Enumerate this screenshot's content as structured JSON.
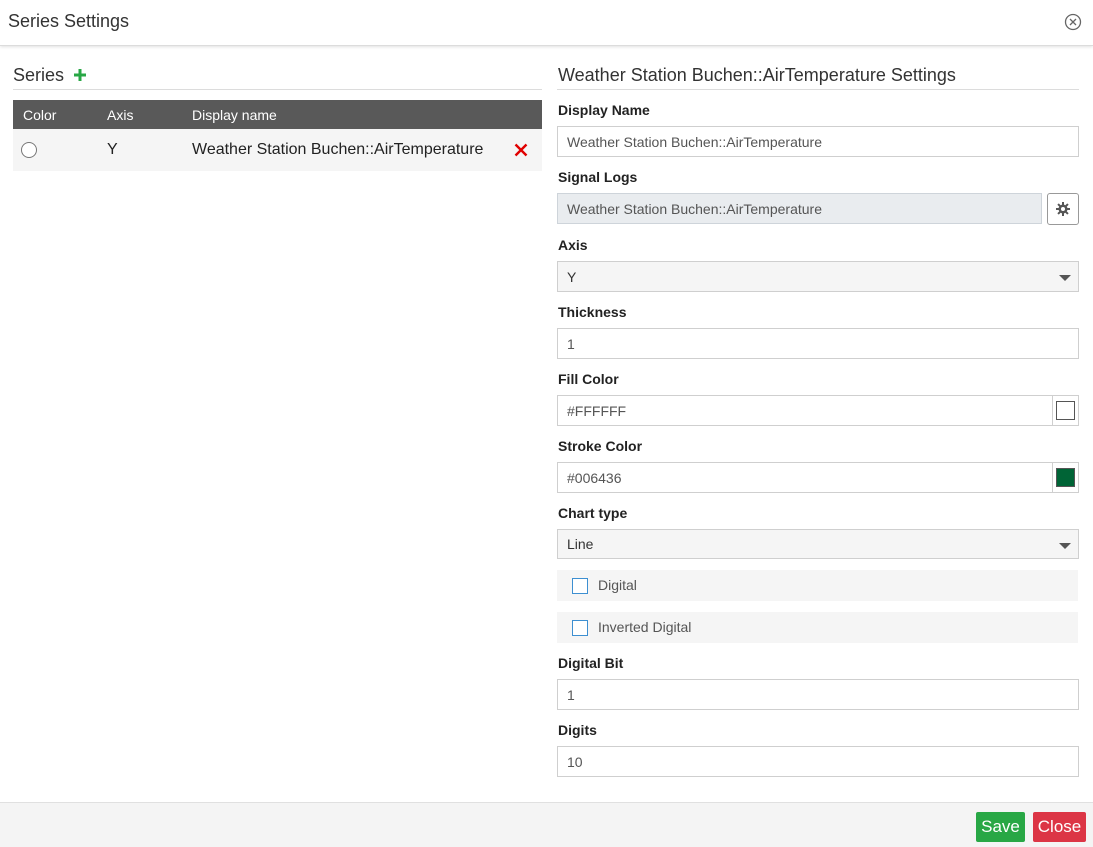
{
  "dialog": {
    "title": "Series Settings"
  },
  "series_panel": {
    "title": "Series",
    "columns": [
      "Color",
      "Axis",
      "Display name"
    ],
    "rows": [
      {
        "axis": "Y",
        "display_name": "Weather Station Buchen::AirTemperature"
      }
    ]
  },
  "settings_panel": {
    "title": "Weather Station Buchen::AirTemperature Settings",
    "display_name": {
      "label": "Display Name",
      "value": "Weather Station Buchen::AirTemperature"
    },
    "signal_logs": {
      "label": "Signal Logs",
      "value": "Weather Station Buchen::AirTemperature"
    },
    "axis": {
      "label": "Axis",
      "value": "Y"
    },
    "thickness": {
      "label": "Thickness",
      "value": "1"
    },
    "fill_color": {
      "label": "Fill Color",
      "value": "#FFFFFF"
    },
    "stroke_color": {
      "label": "Stroke Color",
      "value": "#006436"
    },
    "chart_type": {
      "label": "Chart type",
      "value": "Line"
    },
    "digital": {
      "label": "Digital",
      "checked": false
    },
    "inverted_digital": {
      "label": "Inverted Digital",
      "checked": false
    },
    "digital_bit": {
      "label": "Digital Bit",
      "value": "1"
    },
    "digits": {
      "label": "Digits",
      "value": "10"
    }
  },
  "footer": {
    "save_label": "Save",
    "close_label": "Close"
  },
  "colors": {
    "save_button": "#28a745",
    "close_button": "#dc3545",
    "add_icon": "#28a745",
    "delete_icon": "#e00000"
  }
}
